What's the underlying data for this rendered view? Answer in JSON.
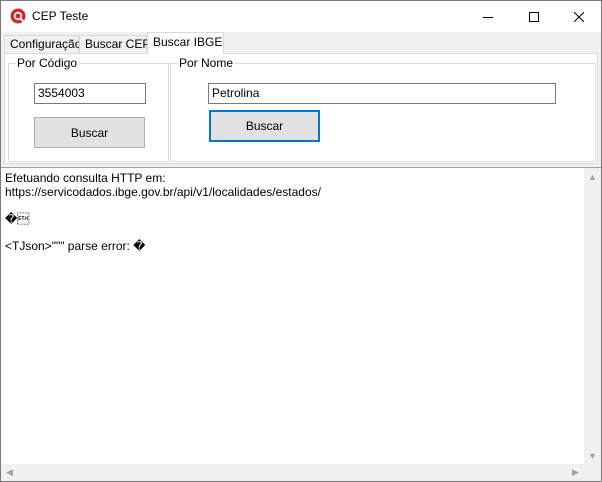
{
  "window": {
    "title": "CEP Teste"
  },
  "tabs": [
    {
      "label": "Configuração"
    },
    {
      "label": "Buscar CEP"
    },
    {
      "label": "Buscar IBGE"
    }
  ],
  "por_codigo": {
    "label": "Por Código",
    "value": "3554003",
    "button_label": "Buscar"
  },
  "por_nome": {
    "label": "Por Nome",
    "value": "Petrolina",
    "button_label": "Buscar"
  },
  "output": {
    "text": "Efetuando consulta HTTP em:\nhttps://servicodados.ibge.gov.br/api/v1/localidades/estados/\n\n�\u0002\n\n<TJson>\"\"\" parse error: �"
  }
}
